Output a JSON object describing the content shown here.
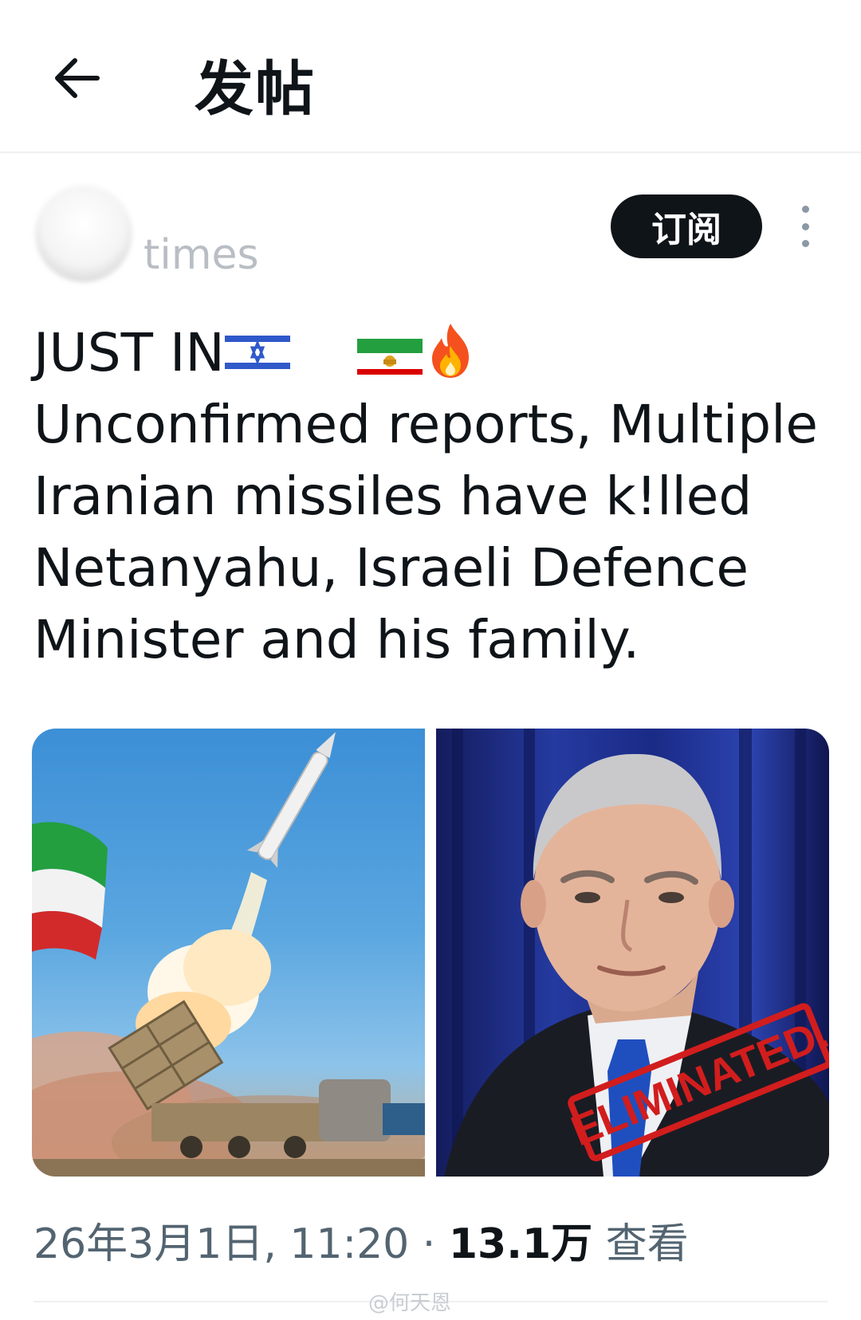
{
  "header": {
    "title": "发帖"
  },
  "author": {
    "name_visible": "times"
  },
  "actions": {
    "subscribe_label": "订阅"
  },
  "tweet": {
    "line1": "JUST IN",
    "line2": "Unconfirmed reports, Multiple",
    "line3": "Iranian missiles have k!lled",
    "line4": "Netanyahu, Israeli Defence",
    "line5": "Minister and his family."
  },
  "media": {
    "stamp_text": "ELIMINATED."
  },
  "meta": {
    "timestamp": "26年3月1日, 11:20",
    "separator": "·",
    "views_count": "13.1万",
    "views_label": "查看"
  },
  "watermark": {
    "text": "@何天恩"
  },
  "colors": {
    "text_primary": "#0f1419",
    "text_secondary": "#536471",
    "subscribe_bg": "#0f1419",
    "divider": "#eef0f2"
  },
  "icons": {
    "back": "arrow-left-icon",
    "more": "more-vertical-icon",
    "flag_israel": "israel-flag-emoji",
    "flag_iran": "iran-lion-sun-flag-emoji",
    "fire": "fire-emoji"
  }
}
